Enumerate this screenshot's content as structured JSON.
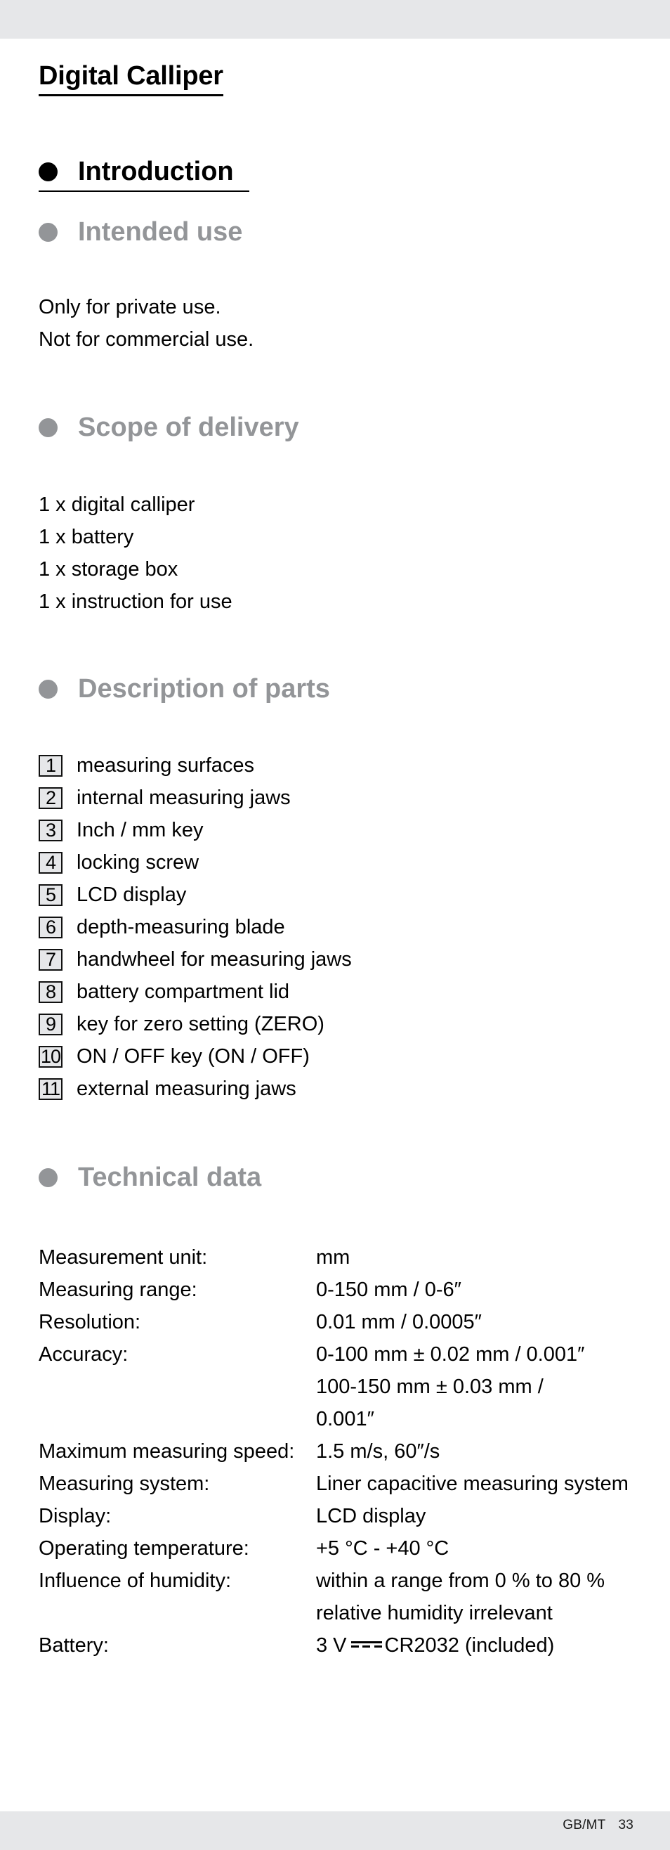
{
  "page": {
    "title": "Digital Calliper",
    "footer": {
      "region": "GB/MT",
      "page_number": "33"
    }
  },
  "sections": {
    "introduction": {
      "heading": "Introduction"
    },
    "intended_use": {
      "heading": "Intended use",
      "lines": [
        "Only for private use.",
        "Not for commercial use."
      ]
    },
    "scope_of_delivery": {
      "heading": "Scope of delivery",
      "items": [
        "1 x digital calliper",
        "1 x battery",
        "1 x storage box",
        "1 x instruction for use"
      ]
    },
    "description_of_parts": {
      "heading": "Description of parts",
      "parts": [
        {
          "number": "1",
          "label": "measuring surfaces"
        },
        {
          "number": "2",
          "label": "internal measuring jaws"
        },
        {
          "number": "3",
          "label": "Inch / mm key"
        },
        {
          "number": "4",
          "label": "locking screw"
        },
        {
          "number": "5",
          "label": "LCD display"
        },
        {
          "number": "6",
          "label": "depth-measuring blade"
        },
        {
          "number": "7",
          "label": "handwheel for measuring jaws"
        },
        {
          "number": "8",
          "label": "battery compartment lid"
        },
        {
          "number": "9",
          "label": "key for zero setting (ZERO)"
        },
        {
          "number": "10",
          "label": "ON / OFF key (ON / OFF)"
        },
        {
          "number": "11",
          "label": "external measuring jaws"
        }
      ]
    },
    "technical_data": {
      "heading": "Technical data",
      "rows": [
        {
          "key": "Measurement unit:",
          "value": [
            "mm"
          ]
        },
        {
          "key": "Measuring range:",
          "value": [
            "0-150 mm / 0-6″"
          ]
        },
        {
          "key": "Resolution:",
          "value": [
            "0.01 mm / 0.0005″"
          ]
        },
        {
          "key": "Accuracy:",
          "value": [
            "0-100 mm ± 0.02 mm / 0.001″",
            "100-150 mm ± 0.03 mm /",
            "0.001″"
          ]
        },
        {
          "key": "Maximum measuring speed:",
          "value": [
            "1.5 m/s, 60″/s"
          ]
        },
        {
          "key": "Measuring system:",
          "value": [
            "Liner capacitive measuring system"
          ]
        },
        {
          "key": "Display:",
          "value": [
            "LCD display"
          ]
        },
        {
          "key": "Operating temperature:",
          "value": [
            "+5 °C - +40 °C"
          ]
        },
        {
          "key": "Influence of humidity:",
          "value": [
            "within a range from 0 % to 80 %",
            "relative humidity irrelevant"
          ]
        }
      ],
      "battery": {
        "key": "Battery:",
        "voltage": "3 V",
        "symbol": "dc-current-symbol",
        "model": "CR2032 (included)"
      }
    }
  },
  "colors": {
    "band": "#e6e7e9",
    "subheading_gray": "#939598",
    "text": "#000000"
  }
}
